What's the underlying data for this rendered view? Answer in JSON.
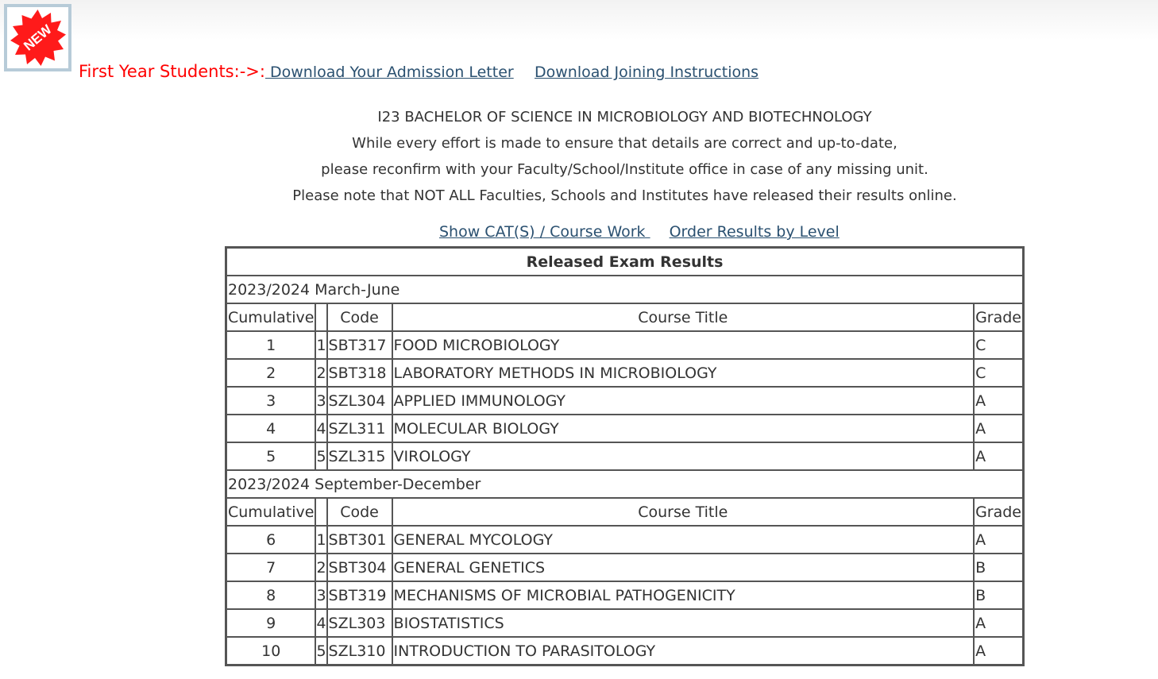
{
  "badge": {
    "text": "NEW",
    "color": "#ff0000"
  },
  "first_year": {
    "label": "First Year Students:->:",
    "admission_link": " Download Your Admission Letter",
    "joining_link": "Download Joining Instructions"
  },
  "info": {
    "programme": "I23 BACHELOR OF SCIENCE IN MICROBIOLOGY AND BIOTECHNOLOGY",
    "line1": "While every effort is made to ensure that details are correct and up-to-date,",
    "line2": "please reconfirm with your Faculty/School/Institute office in case of any missing unit.",
    "line3": "Please note that NOT ALL Faculties, Schools and Institutes have released their results online."
  },
  "links": {
    "show_cats": "Show CAT(S) / Course Work ",
    "order_by_level": "Order Results by Level"
  },
  "results": {
    "title": "Released Exam Results",
    "columns": {
      "cumulative": "Cumulative",
      "code": "Code",
      "course_title": "Course Title",
      "grade": "Grade"
    },
    "semesters": [
      {
        "name": "2023/2024 March-June",
        "rows": [
          {
            "cumulative": "1",
            "n": "1",
            "code": "SBT317",
            "title": "FOOD MICROBIOLOGY",
            "grade": "C"
          },
          {
            "cumulative": "2",
            "n": "2",
            "code": "SBT318",
            "title": "LABORATORY METHODS IN MICROBIOLOGY",
            "grade": "C"
          },
          {
            "cumulative": "3",
            "n": "3",
            "code": "SZL304",
            "title": "APPLIED IMMUNOLOGY",
            "grade": "A"
          },
          {
            "cumulative": "4",
            "n": "4",
            "code": "SZL311",
            "title": "MOLECULAR BIOLOGY",
            "grade": "A"
          },
          {
            "cumulative": "5",
            "n": "5",
            "code": "SZL315",
            "title": "VIROLOGY",
            "grade": "A"
          }
        ]
      },
      {
        "name": "2023/2024 September-December",
        "rows": [
          {
            "cumulative": "6",
            "n": "1",
            "code": "SBT301",
            "title": "GENERAL MYCOLOGY",
            "grade": "A"
          },
          {
            "cumulative": "7",
            "n": "2",
            "code": "SBT304",
            "title": "GENERAL GENETICS",
            "grade": "B"
          },
          {
            "cumulative": "8",
            "n": "3",
            "code": "SBT319",
            "title": "MECHANISMS OF MICROBIAL PATHOGENICITY",
            "grade": "B"
          },
          {
            "cumulative": "9",
            "n": "4",
            "code": "SZL303",
            "title": "BIOSTATISTICS",
            "grade": "A"
          },
          {
            "cumulative": "10",
            "n": "5",
            "code": "SZL310",
            "title": "INTRODUCTION TO PARASITOLOGY",
            "grade": "A"
          }
        ]
      }
    ]
  }
}
